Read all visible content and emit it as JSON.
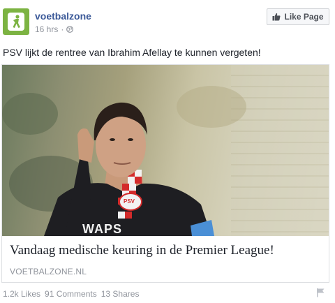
{
  "header": {
    "page_name": "voetbalzone",
    "timestamp": "16 hrs",
    "separator": "·",
    "like_page_label": "Like Page"
  },
  "post": {
    "text": "PSV lijkt de rentree van Ibrahim Afellay te kunnen vergeten!"
  },
  "link": {
    "title": "Vandaag medische keuring in de Premier League!",
    "domain": "VOETBALZONE.NL"
  },
  "jersey": {
    "sponsor_text": "WAPS",
    "crest_text": "PSV"
  },
  "stats": {
    "likes": "1.2k Likes",
    "comments": "91 Comments",
    "shares": "13 Shares"
  },
  "colors": {
    "brand_green": "#7cb342",
    "link_blue": "#3b5998",
    "muted": "#90949c"
  },
  "icons": [
    "globe-icon",
    "thumbs-up-icon",
    "flag-icon",
    "voetbalzone-logo-icon"
  ]
}
